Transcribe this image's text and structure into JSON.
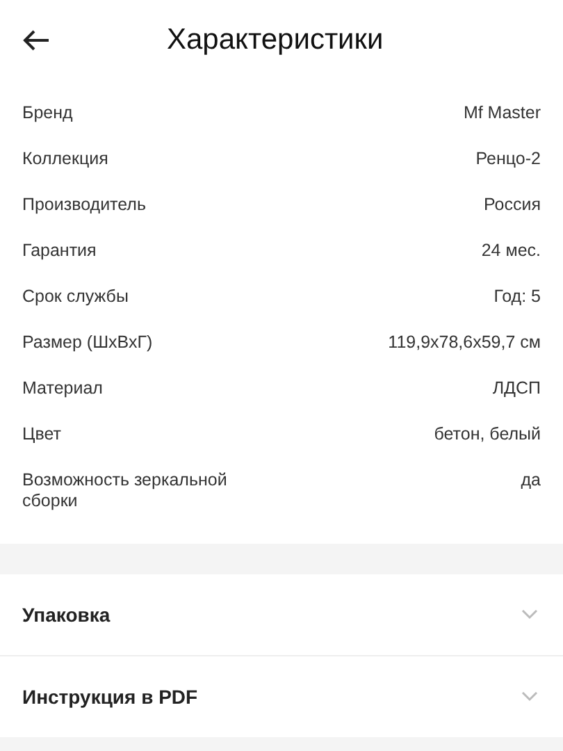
{
  "header": {
    "title": "Характеристики"
  },
  "specs": [
    {
      "label": "Бренд",
      "value": "Mf Master"
    },
    {
      "label": "Коллекция",
      "value": "Ренцо-2"
    },
    {
      "label": "Производитель",
      "value": "Россия"
    },
    {
      "label": "Гарантия",
      "value": "24 мес."
    },
    {
      "label": "Срок службы",
      "value": "Год: 5"
    },
    {
      "label": "Размер (ШхВхГ)",
      "value": "119,9x78,6x59,7 см"
    },
    {
      "label": "Материал",
      "value": "ЛДСП"
    },
    {
      "label": "Цвет",
      "value": "бетон, белый"
    },
    {
      "label": "Возможность зеркальной сборки",
      "value": "да"
    }
  ],
  "sections": [
    {
      "title": "Упаковка",
      "expanded": false
    },
    {
      "title": "Инструкция в PDF",
      "expanded": false
    }
  ]
}
